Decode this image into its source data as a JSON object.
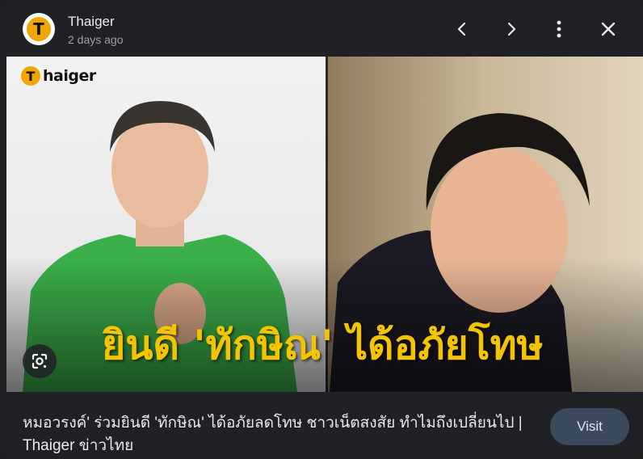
{
  "source": {
    "name": "Thaiger",
    "time": "2 days ago",
    "logo_letter": "T"
  },
  "toolbar": {
    "prev_icon": "chevron-left-icon",
    "next_icon": "chevron-right-icon",
    "more_icon": "more-vert-icon",
    "close_icon": "close-icon"
  },
  "image": {
    "watermark_letter": "T",
    "watermark_text": "haiger",
    "headline": "ยินดี 'ทักษิณ' ได้อภัยโทษ",
    "headline_color": "#f5c400",
    "lens_icon": "google-lens-icon"
  },
  "result": {
    "caption": "หมอวรงค์' ร่วมยินดี 'ทักษิณ' ได้อภัยลดโทษ ชาวเน็ตสงสัย ทำไมถึงเปลี่ยนไป | Thaiger ข่าวไทย",
    "visit_label": "Visit"
  },
  "colors": {
    "background": "#202124",
    "accent": "#f0a500",
    "visit_button": "#3c4a5e"
  }
}
